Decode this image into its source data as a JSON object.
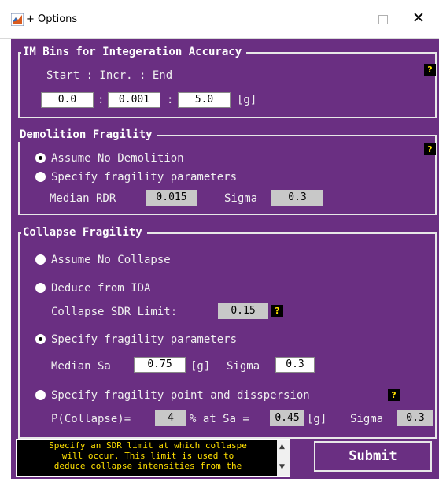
{
  "window": {
    "title": "+ Options"
  },
  "im_bins": {
    "title": "IM Bins for Integeration Accuracy",
    "header": "Start : Incr. :  End",
    "start": "0.0",
    "sep1": ":",
    "incr": "0.001",
    "sep2": ":",
    "end": "5.0",
    "unit": "[g]",
    "help": "?"
  },
  "demolition": {
    "title": "Demolition Fragility",
    "opt_none": "Assume No Demolition",
    "opt_specify": "Specify fragility parameters",
    "median_label": "Median RDR",
    "median_value": "0.015",
    "sigma_label": "Sigma",
    "sigma_value": "0.3",
    "help": "?"
  },
  "collapse": {
    "title": "Collapse Fragility",
    "opt_none": "Assume No Collapse",
    "opt_ida": "Deduce from IDA",
    "sdr_label": "Collapse SDR Limit:",
    "sdr_value": "0.15",
    "sdr_help": "?",
    "opt_specify": "Specify fragility parameters",
    "median_label": "Median Sa",
    "median_value": "0.75",
    "median_unit": "[g]",
    "sigma_label": "Sigma",
    "sigma_value": "0.3",
    "opt_point": "Specify fragility point and disspersion",
    "point_help": "?",
    "pc_label": "P(Collapse)=",
    "pc_value": "4",
    "pc_mid": "% at Sa =",
    "sa_value": "0.45",
    "sa_unit": "[g]",
    "sigma2_label": "Sigma",
    "sigma2_value": "0.3"
  },
  "message": "Specify an SDR limit at which collaspe\nwill occur. This limit is used to\ndeduce collapse intensities from the",
  "submit_label": "Submit",
  "colors": {
    "background": "#6a2f82",
    "help_bg": "#000000",
    "help_fg": "#ffe000"
  }
}
